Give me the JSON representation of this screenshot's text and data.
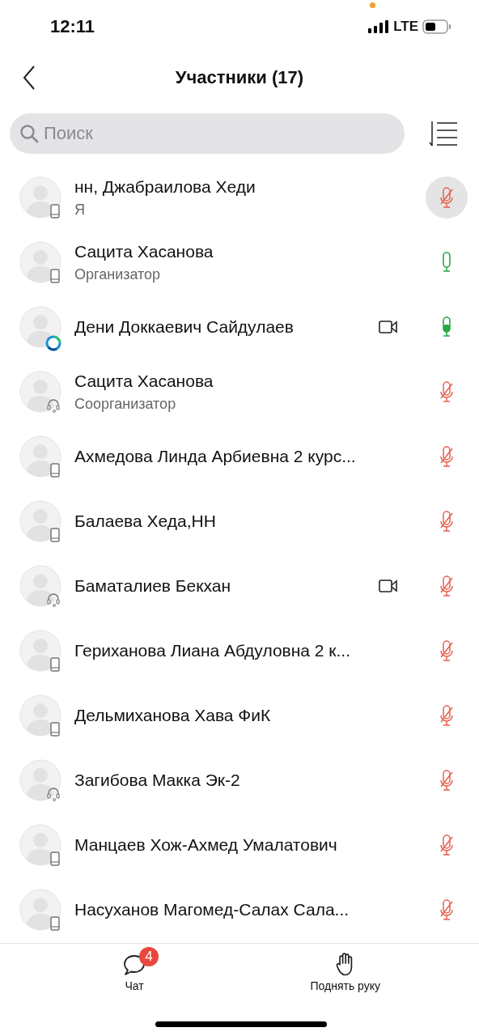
{
  "status_bar": {
    "time": "12:11",
    "network": "LTE"
  },
  "header": {
    "title": "Участники (17)"
  },
  "search": {
    "placeholder": "Поиск"
  },
  "participants": [
    {
      "name": "нн, Джабраилова Хеди",
      "role": "Я",
      "kind": "phone",
      "video": false,
      "muted": true,
      "selected": true
    },
    {
      "name": "Сацита Хасанова",
      "role": "Организатор",
      "kind": "phone",
      "video": false,
      "muted": false,
      "speaking": false,
      "selected": false
    },
    {
      "name": "Дени Доккаевич Сайдулаев",
      "kind": "app",
      "video": true,
      "muted": false,
      "speaking": true,
      "selected": false
    },
    {
      "name": "Сацита Хасанова",
      "role": "Соорганизатор",
      "kind": "headset",
      "video": false,
      "muted": true,
      "selected": false
    },
    {
      "name": "Ахмедова Линда Арбиевна 2 курс...",
      "kind": "phone",
      "video": false,
      "muted": true,
      "selected": false
    },
    {
      "name": "Балаева Хеда,НН",
      "kind": "phone",
      "video": false,
      "muted": true,
      "selected": false
    },
    {
      "name": "Баматалиев Бекхан",
      "kind": "headset",
      "video": true,
      "muted": true,
      "selected": false
    },
    {
      "name": "Гериханова Лиана Абдуловна 2 к...",
      "kind": "phone",
      "video": false,
      "muted": true,
      "selected": false
    },
    {
      "name": "Дельмиханова Хава ФиК",
      "kind": "phone",
      "video": false,
      "muted": true,
      "selected": false
    },
    {
      "name": "Загибова Макка Эк-2",
      "kind": "headset",
      "video": false,
      "muted": true,
      "selected": false
    },
    {
      "name": "Манцаев Хож-Ахмед Умалатович",
      "kind": "phone",
      "video": false,
      "muted": true,
      "selected": false
    },
    {
      "name": "Насуханов Магомед-Салах Сала...",
      "kind": "phone",
      "video": false,
      "muted": true,
      "selected": false
    }
  ],
  "bottom_bar": [
    {
      "kind": "chat",
      "label": "Чат",
      "badge": "4"
    },
    {
      "kind": "hand",
      "label": "Поднять руку"
    }
  ]
}
